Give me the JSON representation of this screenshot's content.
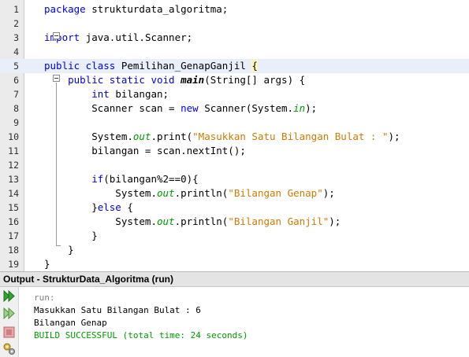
{
  "editor": {
    "current_line": 5,
    "lines": [
      {
        "n": "1",
        "tokens": [
          {
            "t": "package ",
            "c": "kw"
          },
          {
            "t": "strukturdata_algoritma;",
            "c": "plain"
          }
        ]
      },
      {
        "n": "2",
        "tokens": []
      },
      {
        "n": "3",
        "tokens": [
          {
            "t": "import ",
            "c": "kw"
          },
          {
            "t": "java.util.Scanner;",
            "c": "plain"
          }
        ]
      },
      {
        "n": "4",
        "tokens": []
      },
      {
        "n": "5",
        "tokens": [
          {
            "t": "public class ",
            "c": "kw"
          },
          {
            "t": "Pemilihan_GenapGanjil ",
            "c": "plain"
          },
          {
            "t": "{",
            "c": "plain hl"
          }
        ]
      },
      {
        "n": "6",
        "tokens": [
          {
            "t": "    public static void ",
            "c": "kw"
          },
          {
            "t": "main",
            "c": "boldit"
          },
          {
            "t": "(String[] ",
            "c": "plain"
          },
          {
            "t": "args",
            "c": "plain"
          },
          {
            "t": ") {",
            "c": "plain"
          }
        ]
      },
      {
        "n": "7",
        "tokens": [
          {
            "t": "        int ",
            "c": "kw"
          },
          {
            "t": "bilangan;",
            "c": "plain"
          }
        ]
      },
      {
        "n": "8",
        "tokens": [
          {
            "t": "        Scanner scan = ",
            "c": "plain"
          },
          {
            "t": "new ",
            "c": "kw"
          },
          {
            "t": "Scanner(System.",
            "c": "plain"
          },
          {
            "t": "in",
            "c": "fld"
          },
          {
            "t": ");",
            "c": "plain"
          }
        ]
      },
      {
        "n": "9",
        "tokens": []
      },
      {
        "n": "10",
        "tokens": [
          {
            "t": "        System.",
            "c": "plain"
          },
          {
            "t": "out",
            "c": "fld"
          },
          {
            "t": ".print(",
            "c": "plain"
          },
          {
            "t": "\"Masukkan Satu Bilangan Bulat : \"",
            "c": "str"
          },
          {
            "t": ");",
            "c": "plain"
          }
        ]
      },
      {
        "n": "11",
        "tokens": [
          {
            "t": "        bilangan = scan.nextInt();",
            "c": "plain"
          }
        ]
      },
      {
        "n": "12",
        "tokens": []
      },
      {
        "n": "13",
        "tokens": [
          {
            "t": "        if",
            "c": "kw"
          },
          {
            "t": "(bilangan%2==0){",
            "c": "plain"
          }
        ]
      },
      {
        "n": "14",
        "tokens": [
          {
            "t": "            System.",
            "c": "plain"
          },
          {
            "t": "out",
            "c": "fld"
          },
          {
            "t": ".println(",
            "c": "plain"
          },
          {
            "t": "\"Bilangan Genap\"",
            "c": "str"
          },
          {
            "t": ");",
            "c": "plain"
          }
        ]
      },
      {
        "n": "15",
        "tokens": [
          {
            "t": "        }",
            "c": "plain"
          },
          {
            "t": "else ",
            "c": "kw"
          },
          {
            "t": "{",
            "c": "plain"
          }
        ]
      },
      {
        "n": "16",
        "tokens": [
          {
            "t": "            System.",
            "c": "plain"
          },
          {
            "t": "out",
            "c": "fld"
          },
          {
            "t": ".println(",
            "c": "plain"
          },
          {
            "t": "\"Bilangan Ganjil\"",
            "c": "str"
          },
          {
            "t": ");",
            "c": "plain"
          }
        ]
      },
      {
        "n": "17",
        "tokens": [
          {
            "t": "        }",
            "c": "plain"
          }
        ]
      },
      {
        "n": "18",
        "tokens": [
          {
            "t": "    }",
            "c": "plain"
          }
        ]
      },
      {
        "n": "19",
        "tokens": [
          {
            "t": "}",
            "c": "plain"
          }
        ]
      }
    ]
  },
  "output": {
    "title": "Output - StrukturData_Algoritma (run)",
    "lines": [
      {
        "text": "run:",
        "style": "dim"
      },
      {
        "text": "Masukkan Satu Bilangan Bulat : 6",
        "style": "normal"
      },
      {
        "text": "Bilangan Genap",
        "style": "normal"
      },
      {
        "text": "BUILD SUCCESSFUL (total time: 24 seconds)",
        "style": "ok"
      }
    ],
    "toolbar": [
      {
        "name": "rerun-icon"
      },
      {
        "name": "rerun-with-options-icon"
      },
      {
        "name": "stop-icon"
      },
      {
        "name": "settings-icon"
      }
    ]
  },
  "colors": {
    "keyword": "#0000e6",
    "string": "#ce7b00",
    "field": "#009900",
    "build_success": "#009900",
    "current_line": "#e9eff8",
    "gutter": "#ebebeb"
  }
}
